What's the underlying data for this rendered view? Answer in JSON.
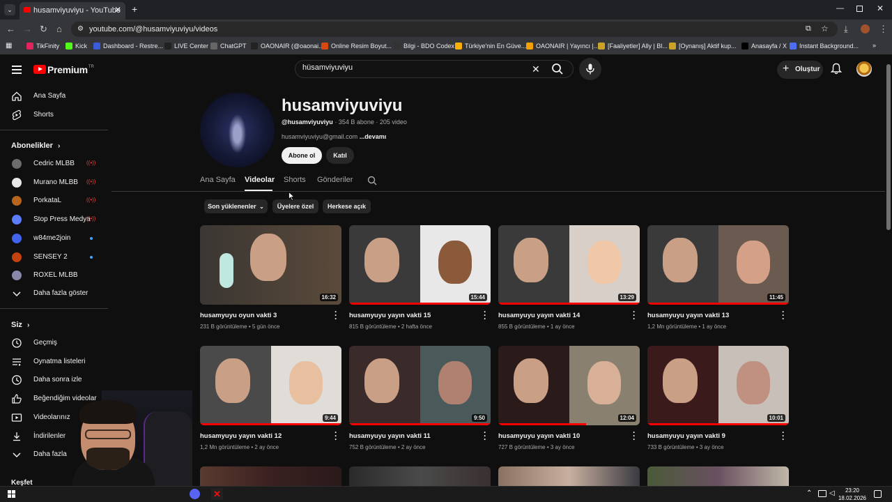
{
  "browser": {
    "tab_title": "husamviyuviyu - YouTube",
    "url": "youtube.com/@husamviyuviyu/videos",
    "bookmarks": [
      {
        "label": "TikFinity",
        "color": "#e0245e"
      },
      {
        "label": "Kick",
        "color": "#53fc18"
      },
      {
        "label": "Dashboard - Restre...",
        "color": "#3b5bdb"
      },
      {
        "label": "LIVE Center",
        "color": "#222222"
      },
      {
        "label": "ChatGPT",
        "color": "#666666"
      },
      {
        "label": "OAONAIR (@oaonai...",
        "color": "#222222"
      },
      {
        "label": "Online Resim Boyut...",
        "color": "#d9480f"
      },
      {
        "label": "Bilgi - BDO Codex",
        "color": "#333333"
      },
      {
        "label": "Türkiye'nin En Güve...",
        "color": "#fab005"
      },
      {
        "label": "OAONAIR | Yayıncı |...",
        "color": "#f59f00"
      },
      {
        "label": "[Faaliyetler] Ally | Bl...",
        "color": "#c9a227"
      },
      {
        "label": "[Oynanış] Aktif kup...",
        "color": "#c9a227"
      },
      {
        "label": "Anasayfa / X",
        "color": "#000000"
      },
      {
        "label": "Instant Background...",
        "color": "#4c6ef5"
      }
    ]
  },
  "header": {
    "logo_text": "Premium",
    "logo_region": "TR",
    "search_value": "hüsamviyuviyu",
    "create_label": "Oluştur"
  },
  "sidebar": {
    "main": [
      {
        "label": "Ana Sayfa",
        "icon": "home-icon"
      },
      {
        "label": "Shorts",
        "icon": "shorts-icon"
      }
    ],
    "subscriptions_title": "Abonelikler",
    "subscriptions": [
      {
        "label": "Cedric MLBB",
        "status": "live",
        "color": "#6c6c6c"
      },
      {
        "label": "Murano MLBB",
        "status": "live",
        "color": "#e8e8e8"
      },
      {
        "label": "PorkataL",
        "status": "live",
        "color": "#b5651d"
      },
      {
        "label": "Stop Press Medya",
        "status": "live",
        "color": "#5c7cfa"
      },
      {
        "label": "w84me2join",
        "status": "new",
        "color": "#4263eb"
      },
      {
        "label": "SENSEY 2",
        "status": "new",
        "color": "#c2410c"
      },
      {
        "label": "ROXEL MLBB",
        "status": "",
        "color": "#8888aa"
      }
    ],
    "show_more": "Daha fazla göster",
    "you_title": "Siz",
    "you_items": [
      {
        "label": "Geçmiş",
        "icon": "history-icon"
      },
      {
        "label": "Oynatma listeleri",
        "icon": "playlists-icon"
      },
      {
        "label": "Daha sonra izle",
        "icon": "watch-later-icon"
      },
      {
        "label": "Beğendiğim videolar",
        "icon": "like-icon"
      },
      {
        "label": "Videolarınız",
        "icon": "your-videos-icon"
      },
      {
        "label": "İndirilenler",
        "icon": "download-icon"
      },
      {
        "label": "Daha fazla",
        "icon": "chevron-down-icon"
      }
    ],
    "next_section": "Keşfet"
  },
  "channel": {
    "name": "husamviyuviyu",
    "handle": "@husamviyuviyu",
    "subscribers": "354 B abone",
    "video_count": "205 video",
    "description": "husamviyuviyu@gmail.com",
    "more_label": "...devamı",
    "subscribe_label": "Abone ol",
    "join_label": "Katıl",
    "tabs": [
      "Ana Sayfa",
      "Videolar",
      "Shorts",
      "Gönderiler"
    ],
    "active_tab": "Videolar",
    "chips": [
      "Son yüklenenler",
      "Üyelere özel",
      "Herkese açık"
    ]
  },
  "videos": [
    {
      "title": "husamyuyu oyun vakti 3",
      "views": "231 B görüntüleme",
      "age": "5 gün önce",
      "duration": "16:32",
      "progress": 0,
      "split": false,
      "bg": [
        "#3a3632",
        "#5a4a3a"
      ],
      "face": [
        "#c9a086",
        "#8a6a5a"
      ]
    },
    {
      "title": "husamyuyu yayın vakti 15",
      "views": "815 B görüntüleme",
      "age": "2 hafta önce",
      "duration": "15:44",
      "progress": 1.0,
      "split": true,
      "bg": [
        "#3a3a3a",
        "#e8e8e8"
      ],
      "face": [
        "#c9a086",
        "#8a5a3a"
      ]
    },
    {
      "title": "husamyuyu yayın vakti 14",
      "views": "855 B görüntüleme",
      "age": "1 ay önce",
      "duration": "13:29",
      "progress": 1.0,
      "split": true,
      "bg": [
        "#3a3a3a",
        "#d9cfc9"
      ],
      "face": [
        "#c9a086",
        "#f0c8a8"
      ]
    },
    {
      "title": "husamyuyu yayın vakti 13",
      "views": "1,2 Mn görüntüleme",
      "age": "1 ay önce",
      "duration": "11:45",
      "progress": 1.0,
      "split": true,
      "bg": [
        "#3a3a3a",
        "#6a5a50"
      ],
      "face": [
        "#c9a086",
        "#d4a088"
      ]
    },
    {
      "title": "husamyuyu yayın vakti 12",
      "views": "1,2 Mn görüntüleme",
      "age": "2 ay önce",
      "duration": "9:44",
      "progress": 1.0,
      "split": true,
      "bg": [
        "#4a4a4a",
        "#e0dcd8"
      ],
      "face": [
        "#c9a086",
        "#e8c0a0"
      ]
    },
    {
      "title": "husamyuyu yayın vakti 11",
      "views": "752 B görüntüleme",
      "age": "2 ay önce",
      "duration": "9:50",
      "progress": 1.0,
      "split": true,
      "bg": [
        "#3a2a2a",
        "#4a5a5a"
      ],
      "face": [
        "#c9a086",
        "#b08070"
      ]
    },
    {
      "title": "husamyuyu yayın vakti 10",
      "views": "727 B görüntüleme",
      "age": "3 ay önce",
      "duration": "12:04",
      "progress": 0.62,
      "split": true,
      "bg": [
        "#2a1a1a",
        "#8a8070"
      ],
      "face": [
        "#c9a086",
        "#d8b098"
      ]
    },
    {
      "title": "husamyuyu yayın vakti 9",
      "views": "733 B görüntüleme",
      "age": "3 ay önce",
      "duration": "10:01",
      "progress": 1.0,
      "split": true,
      "bg": [
        "#3a1a1a",
        "#c8c0b8"
      ],
      "face": [
        "#c9a086",
        "#c09080"
      ]
    }
  ],
  "taskbar": {
    "time": "23:20",
    "date": "18.02.2026"
  }
}
